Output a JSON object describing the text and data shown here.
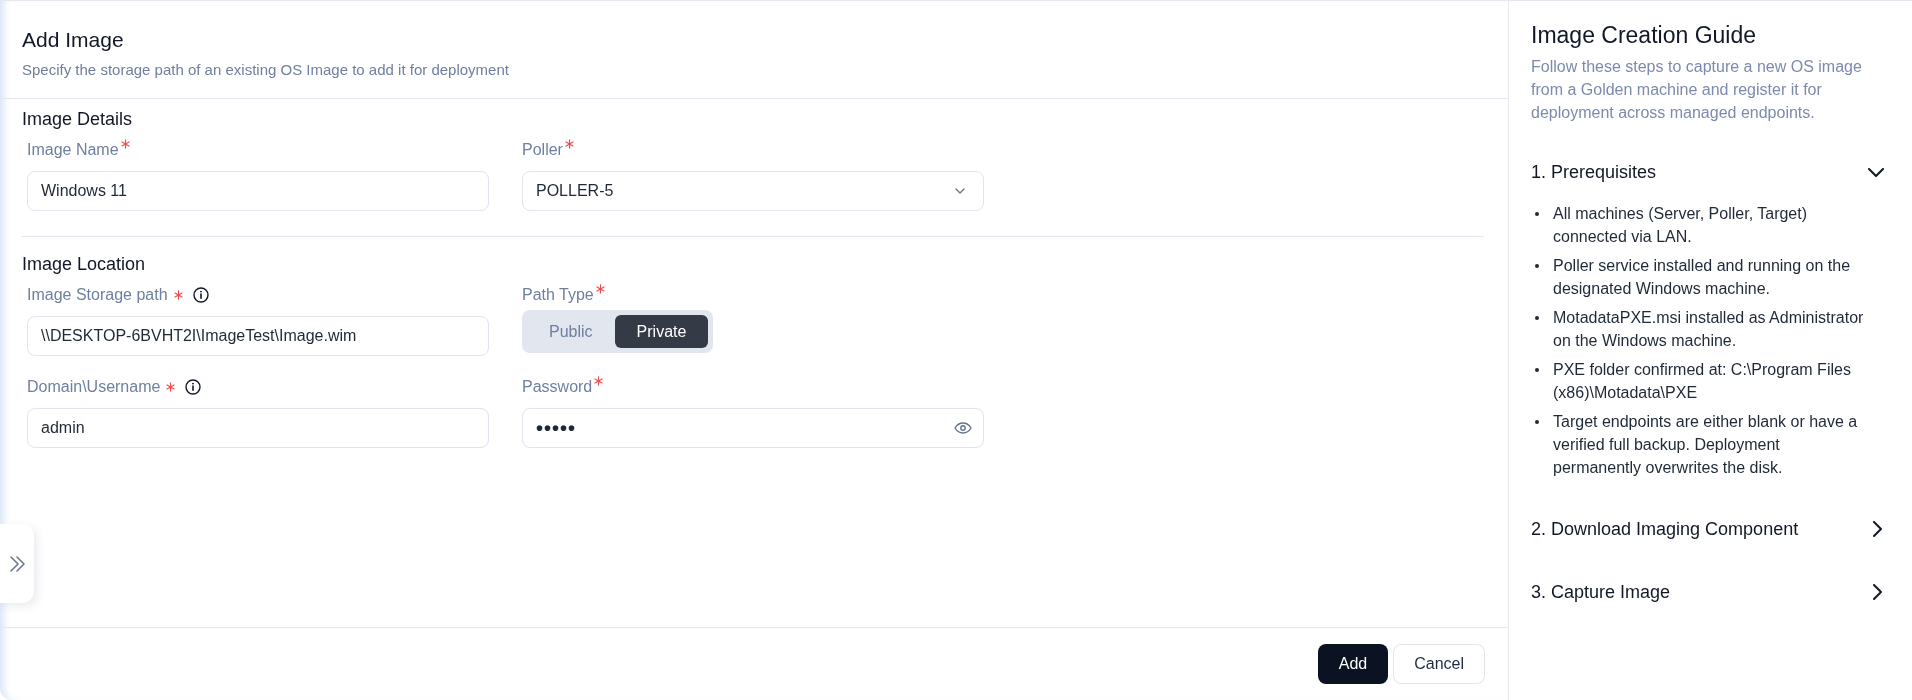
{
  "form": {
    "title": "Add Image",
    "subtitle": "Specify the storage path of an existing OS Image to add it for deployment",
    "sections": [
      {
        "title": "Image Details",
        "fields": [
          {
            "kind": "text",
            "label": "Image Name",
            "required": true,
            "info": false,
            "value": "Windows 11"
          },
          {
            "kind": "select",
            "label": "Poller",
            "required": true,
            "info": false,
            "value": "POLLER-5"
          }
        ]
      },
      {
        "title": "Image Location",
        "fields": [
          {
            "kind": "text",
            "label": "Image Storage path",
            "required": true,
            "info": true,
            "value": "\\\\DESKTOP-6BVHT2I\\ImageTest\\Image.wim"
          },
          {
            "kind": "toggle",
            "label": "Path Type",
            "required": true,
            "info": false,
            "options": [
              {
                "label": "Public",
                "selected": false
              },
              {
                "label": "Private",
                "selected": true
              }
            ]
          },
          {
            "kind": "text",
            "label": "Domain\\Username",
            "required": true,
            "info": true,
            "value": "admin"
          },
          {
            "kind": "password",
            "label": "Password",
            "required": true,
            "info": false,
            "value": "•••••"
          }
        ]
      }
    ],
    "buttons": [
      {
        "kind": "primary",
        "label": "Add"
      },
      {
        "kind": "secondary",
        "label": "Cancel"
      }
    ]
  },
  "guide": {
    "title": "Image Creation Guide",
    "description": "Follow these steps to capture a new OS image from a Golden machine and register it for deployment across managed endpoints.",
    "steps": [
      {
        "title": "1. Prerequisites",
        "expanded": true,
        "items": [
          "All machines (Server, Poller, Target) connected via LAN.",
          "Poller service installed and running on the designated Windows machine.",
          "MotadataPXE.msi installed as Administrator on the Windows machine.",
          "PXE folder confirmed at: C:\\Program Files (x86)\\Motadata\\PXE",
          "Target endpoints are either blank or have a verified full backup. Deployment permanently overwrites the disk."
        ]
      },
      {
        "title": "2. Download Imaging Component",
        "expanded": false
      },
      {
        "title": "3. Capture Image",
        "expanded": false
      }
    ]
  }
}
